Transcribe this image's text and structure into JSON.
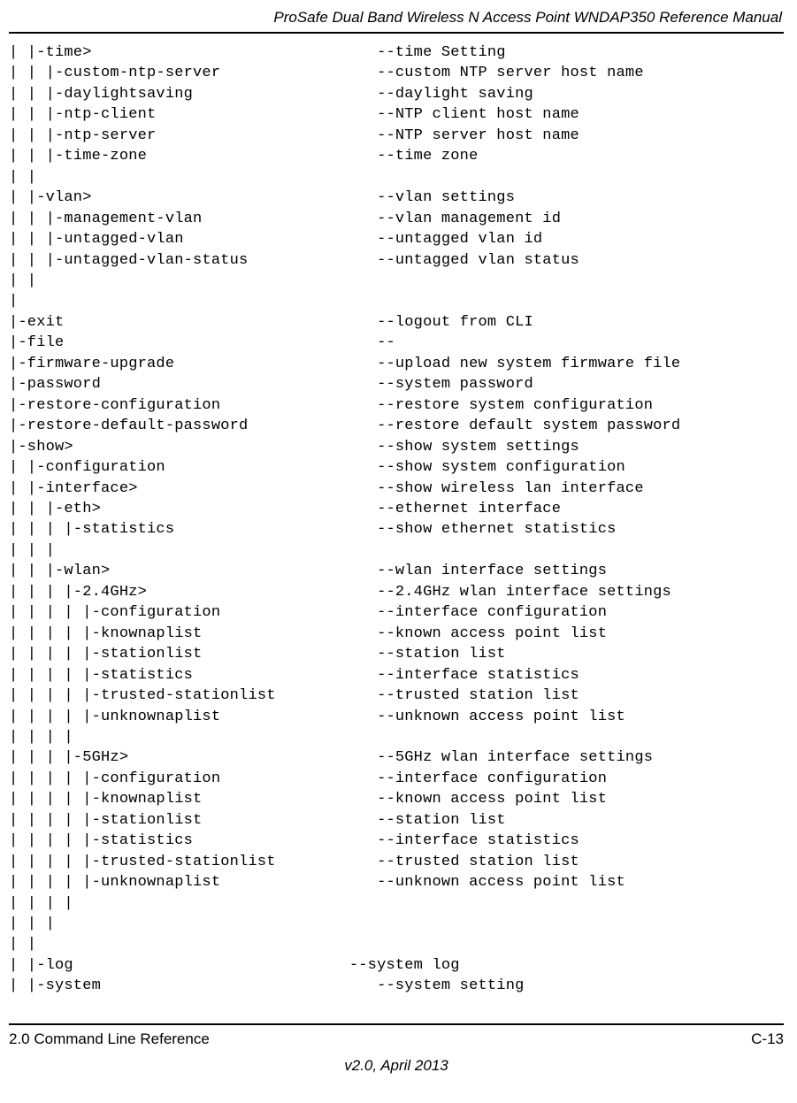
{
  "header": {
    "title": "ProSafe Dual Band Wireless N Access Point WNDAP350 Reference Manual"
  },
  "cli": {
    "lines": [
      "| |-time>                               --time Setting",
      "| | |-custom-ntp-server                 --custom NTP server host name",
      "| | |-daylightsaving                    --daylight saving",
      "| | |-ntp-client                        --NTP client host name",
      "| | |-ntp-server                        --NTP server host name",
      "| | |-time-zone                         --time zone",
      "| |",
      "| |-vlan>                               --vlan settings",
      "| | |-management-vlan                   --vlan management id",
      "| | |-untagged-vlan                     --untagged vlan id",
      "| | |-untagged-vlan-status              --untagged vlan status",
      "| |",
      "|",
      "|-exit                                  --logout from CLI",
      "|-file                                  --",
      "|-firmware-upgrade                      --upload new system firmware file",
      "|-password                              --system password",
      "|-restore-configuration                 --restore system configuration",
      "|-restore-default-password              --restore default system password",
      "|-show>                                 --show system settings",
      "| |-configuration                       --show system configuration",
      "| |-interface>                          --show wireless lan interface",
      "| | |-eth>                              --ethernet interface",
      "| | | |-statistics                      --show ethernet statistics",
      "| | |",
      "| | |-wlan>                             --wlan interface settings",
      "| | | |-2.4GHz>                         --2.4GHz wlan interface settings",
      "| | | | |-configuration                 --interface configuration",
      "| | | | |-knownaplist                   --known access point list",
      "| | | | |-stationlist                   --station list",
      "| | | | |-statistics                    --interface statistics",
      "| | | | |-trusted-stationlist           --trusted station list",
      "| | | | |-unknownaplist                 --unknown access point list",
      "| | | |",
      "| | | |-5GHz>                           --5GHz wlan interface settings",
      "| | | | |-configuration                 --interface configuration",
      "| | | | |-knownaplist                   --known access point list",
      "| | | | |-stationlist                   --station list",
      "| | | | |-statistics                    --interface statistics",
      "| | | | |-trusted-stationlist           --trusted station list",
      "| | | | |-unknownaplist                 --unknown access point list",
      "| | | |",
      "| | |",
      "| |",
      "| |-log                              --system log",
      "| |-system                              --system setting"
    ]
  },
  "footer": {
    "left": "2.0 Command Line Reference",
    "right": "C-13",
    "version": "v2.0, April 2013"
  }
}
